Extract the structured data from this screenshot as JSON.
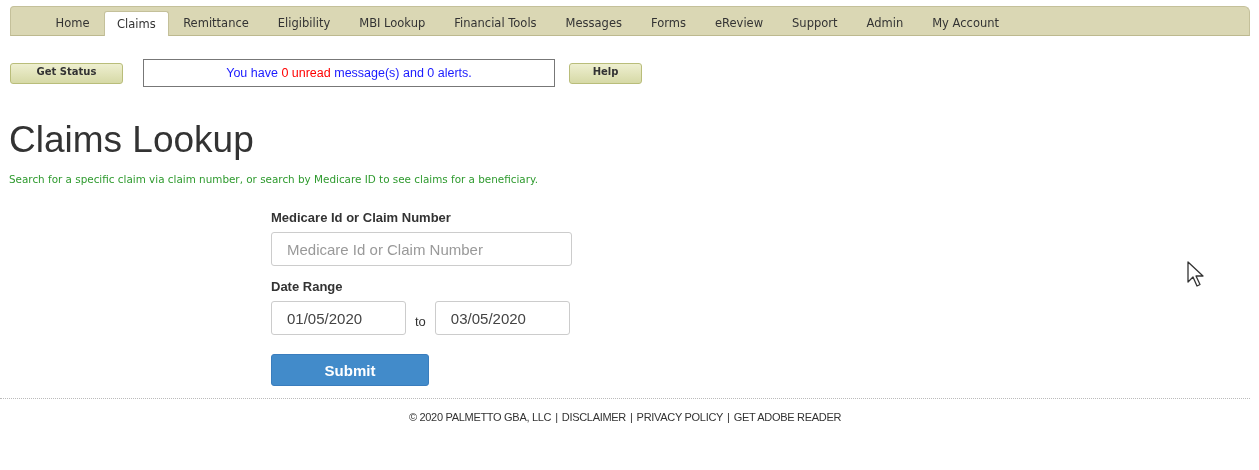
{
  "tabs": [
    {
      "label": "Home",
      "selected": false
    },
    {
      "label": "Claims",
      "selected": true
    },
    {
      "label": "Remittance",
      "selected": false
    },
    {
      "label": "Eligibility",
      "selected": false
    },
    {
      "label": "MBI Lookup",
      "selected": false
    },
    {
      "label": "Financial Tools",
      "selected": false
    },
    {
      "label": "Messages",
      "selected": false
    },
    {
      "label": "Forms",
      "selected": false
    },
    {
      "label": "eReview",
      "selected": false
    },
    {
      "label": "Support",
      "selected": false
    },
    {
      "label": "Admin",
      "selected": false
    },
    {
      "label": "My Account",
      "selected": false
    }
  ],
  "toolbar": {
    "status_button": "Get Status",
    "message_parts": [
      {
        "text": "You have",
        "alert": false
      },
      {
        "text": "0 unread",
        "alert": true
      },
      {
        "text": "message(s) and 0 alerts.",
        "alert": false
      }
    ],
    "help_button": "Help"
  },
  "title": "Claims Lookup",
  "description": "Search for a specific claim via claim number, or search by Medicare ID to see claims for a beneficiary.",
  "form": {
    "id_label": "Medicare Id or Claim Number",
    "id_placeholder": "Medicare Id or Claim Number",
    "date_label": "Date Range",
    "date_from": "01/05/2020",
    "date_separator": "to",
    "date_to": "03/05/2020",
    "submit": "Submit"
  },
  "footer": {
    "separator": "|",
    "items": [
      "© 2020 PALMETTO GBA, LLC",
      "DISCLAIMER",
      "PRIVACY POLICY",
      "GET ADOBE READER"
    ]
  }
}
